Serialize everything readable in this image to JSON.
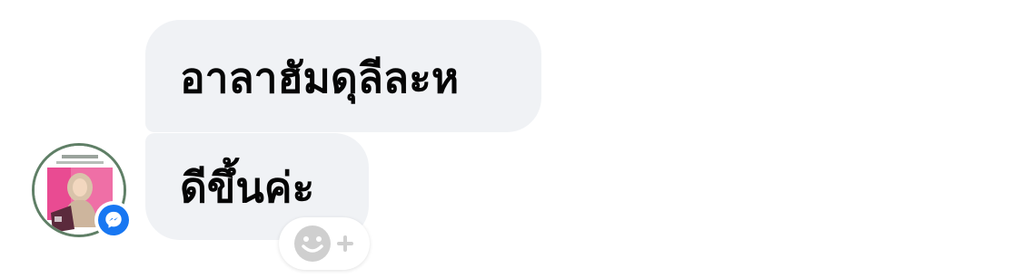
{
  "conversation": {
    "messages": [
      {
        "text": "อาลาฮัมดุลีละห"
      },
      {
        "text": "ดีขึ้นค่ะ"
      }
    ]
  },
  "sender": {
    "avatar_icon": "profile-photo",
    "badge_icon": "messenger-icon"
  },
  "reaction": {
    "icon": "add-reaction-icon"
  },
  "colors": {
    "bubble_bg": "#f0f2f5",
    "text": "#050505",
    "messenger_blue": "#1877f2",
    "avatar_ring": "#5f7f66",
    "reaction_icon": "#c8c8c8"
  }
}
